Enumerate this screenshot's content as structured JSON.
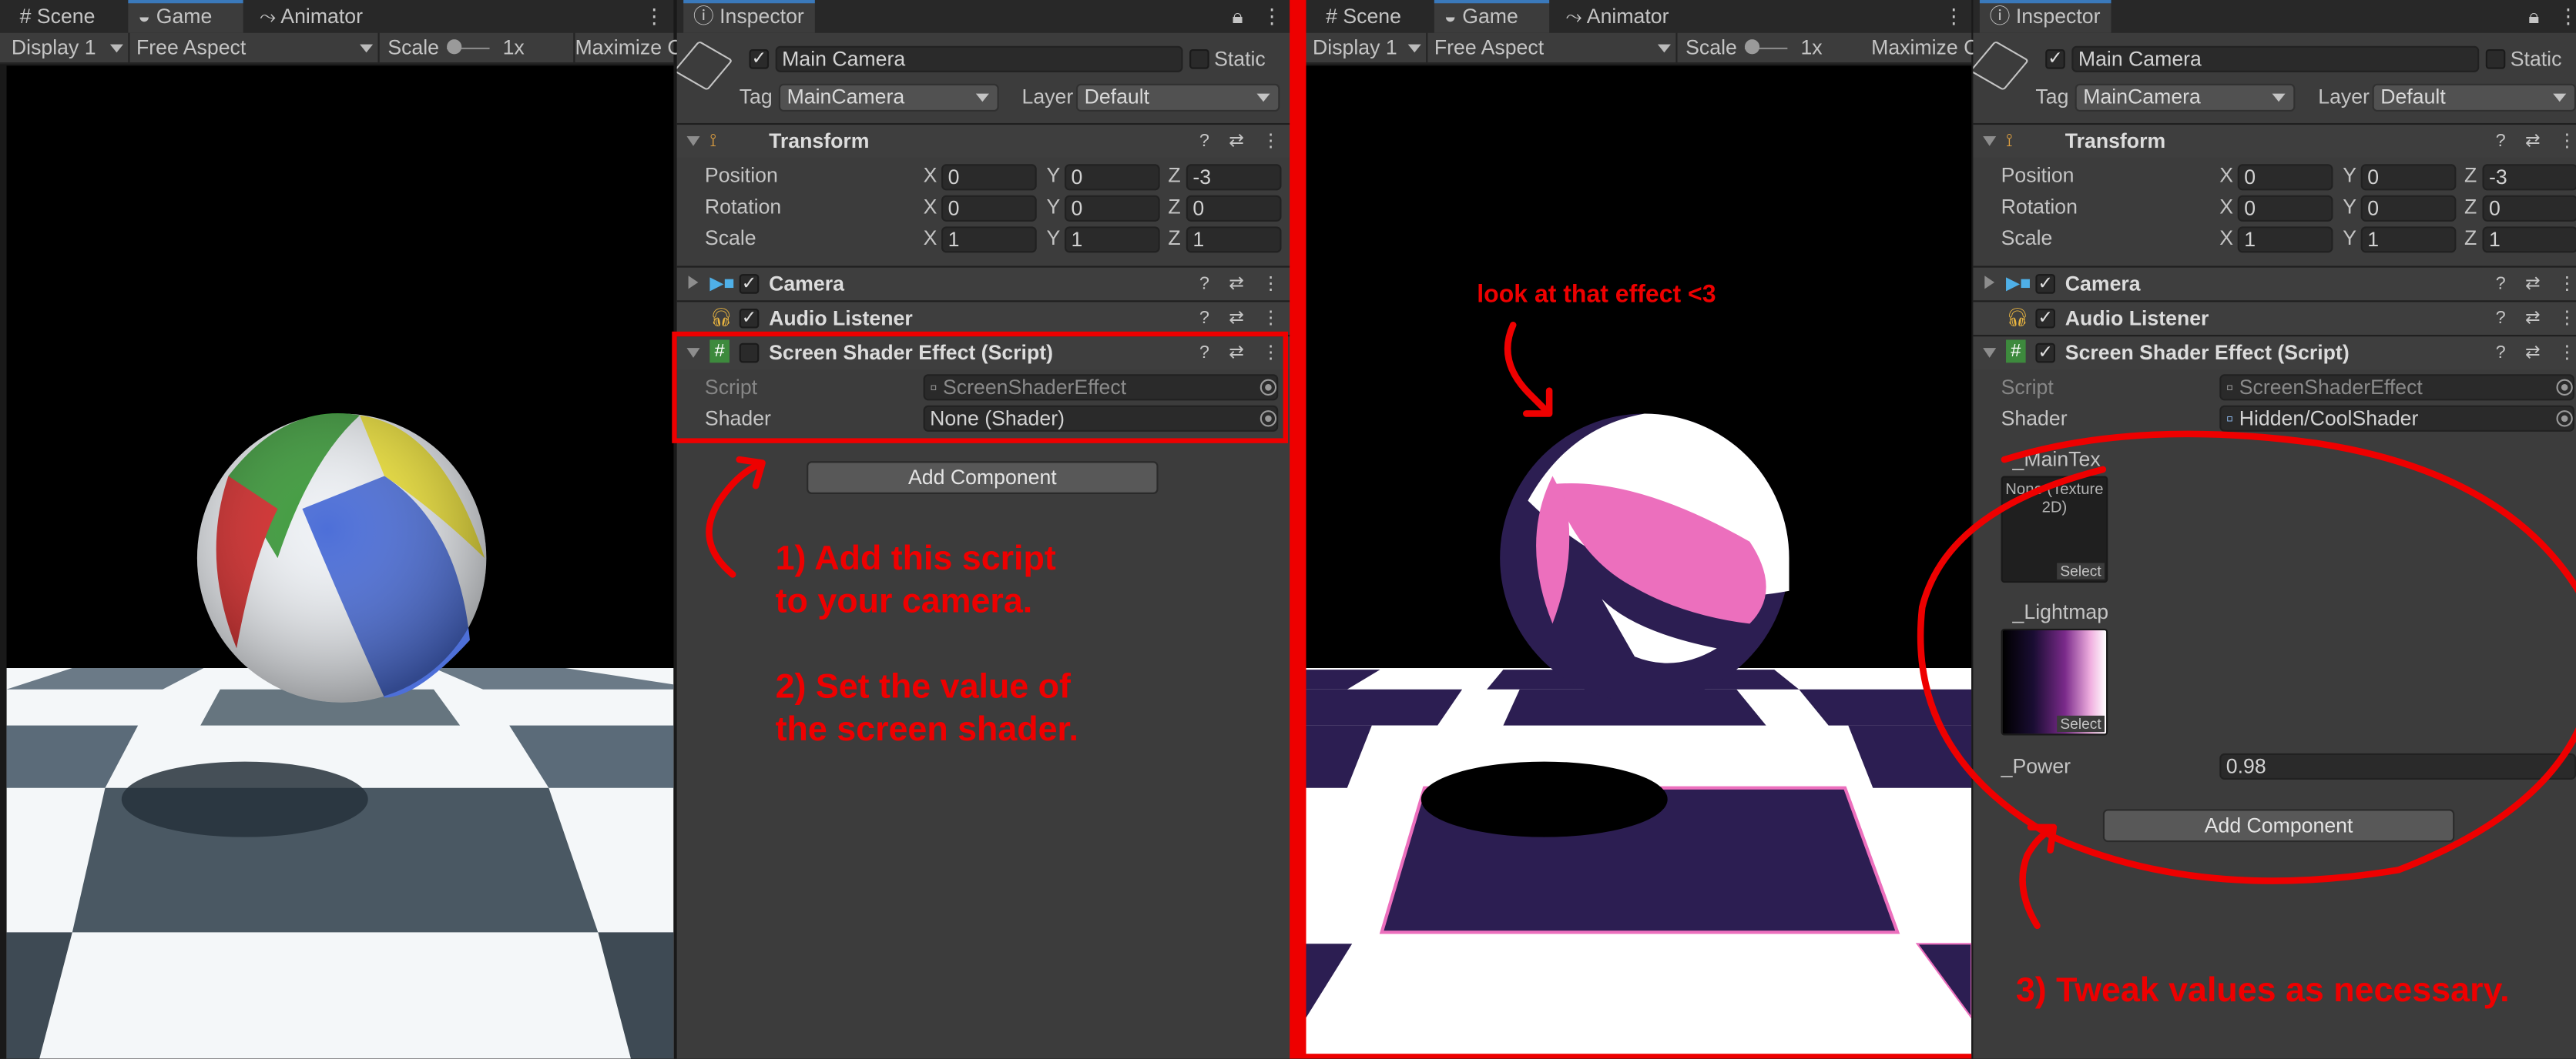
{
  "left": {
    "tabs": {
      "scene": "Scene",
      "game": "Game",
      "animator": "Animator"
    },
    "toolbar": {
      "display": "Display 1",
      "aspect": "Free Aspect",
      "scale_label": "Scale",
      "scale_value": "1x",
      "maximize": "Maximize O"
    },
    "inspector": {
      "tab": "Inspector",
      "object_name": "Main Camera",
      "static_label": "Static",
      "tag_label": "Tag",
      "tag_value": "MainCamera",
      "layer_label": "Layer",
      "layer_value": "Default",
      "transform": {
        "title": "Transform",
        "position": "Position",
        "rotation": "Rotation",
        "scale": "Scale",
        "x": "X",
        "y": "Y",
        "z": "Z",
        "pos": [
          "0",
          "0",
          "-3"
        ],
        "rot": [
          "0",
          "0",
          "0"
        ],
        "scl": [
          "1",
          "1",
          "1"
        ]
      },
      "camera": "Camera",
      "audio": "Audio Listener",
      "script_comp": {
        "title": "Screen Shader Effect (Script)",
        "script_label": "Script",
        "script_value": "ScreenShaderEffect",
        "shader_label": "Shader",
        "shader_value": "None (Shader)"
      },
      "add_component": "Add Component"
    },
    "annotation": {
      "step1_line1": "1) Add this script",
      "step1_line2": "to your camera.",
      "step2_line1": "2) Set the value of",
      "step2_line2": "the screen shader."
    }
  },
  "right": {
    "tabs": {
      "scene": "Scene",
      "game": "Game",
      "animator": "Animator"
    },
    "toolbar": {
      "display": "Display 1",
      "aspect": "Free Aspect",
      "scale_label": "Scale",
      "scale_value": "1x",
      "maximize": "Maximize C"
    },
    "game_caption": "look at that effect <3",
    "inspector": {
      "tab": "Inspector",
      "object_name": "Main Camera",
      "static_label": "Static",
      "tag_label": "Tag",
      "tag_value": "MainCamera",
      "layer_label": "Layer",
      "layer_value": "Default",
      "transform": {
        "title": "Transform",
        "position": "Position",
        "rotation": "Rotation",
        "scale": "Scale",
        "x": "X",
        "y": "Y",
        "z": "Z",
        "pos": [
          "0",
          "0",
          "-3"
        ],
        "rot": [
          "0",
          "0",
          "0"
        ],
        "scl": [
          "1",
          "1",
          "1"
        ]
      },
      "camera": "Camera",
      "audio": "Audio Listener",
      "script_comp": {
        "title": "Screen Shader Effect (Script)",
        "script_label": "Script",
        "script_value": "ScreenShaderEffect",
        "shader_label": "Shader",
        "shader_value": "Hidden/CoolShader"
      },
      "maintex_label": "_MainTex",
      "maintex_value_1": "None (Texture",
      "maintex_value_2": "2D)",
      "select": "Select",
      "lightmap_label": "_Lightmap",
      "power_label": "_Power",
      "power_value": "0.98",
      "add_component": "Add Component"
    },
    "annotation": {
      "step3": "3) Tweak values as necessary."
    }
  },
  "colors": {
    "accent_red": "#ee0000",
    "tab_blue": "#3a79bb",
    "effect_pink": "#ec6fbd",
    "effect_purple": "#2c1e52"
  }
}
